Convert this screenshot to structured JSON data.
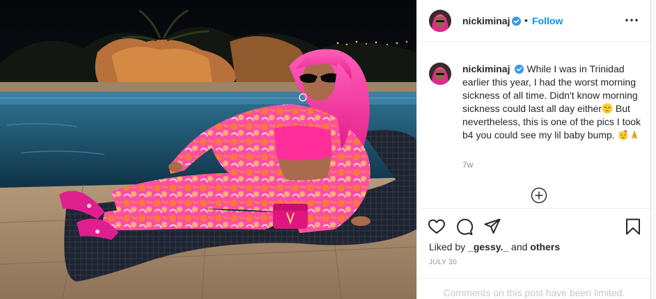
{
  "post": {
    "author": {
      "username": "nickiminaj",
      "verified": true,
      "avatar_icon": "profile-avatar-pink-hair"
    },
    "follow_separator": "•",
    "follow_label": "Follow",
    "more_icon": "ellipsis-icon",
    "photo": {
      "description_icon": "photo-pink-outfit-poolside-lounger"
    },
    "caption": {
      "part1": "While I was in Trinidad earlier this year, I had the worst morning sickness of all time. Didn't know morning sickness could last all day either",
      "emoji1": "weary-face",
      "part2": " But nevertheless, this is one of the pics I took b4 you could see my lil baby bump. ",
      "emoji2": "partying-face",
      "emoji3": "folded-hands"
    },
    "time_ago": "7w",
    "load_more_icon": "plus-circle-icon",
    "actions": {
      "like_icon": "heart-icon",
      "comment_icon": "speech-bubble-icon",
      "share_icon": "paper-plane-icon",
      "save_icon": "bookmark-icon"
    },
    "likes": {
      "prefix": "Liked by ",
      "user": "_gessy._",
      "middle": " and ",
      "others": "others"
    },
    "date": "JULY 30",
    "comments_notice": "Comments on this post have been limited."
  },
  "colors": {
    "link": "#0095f6",
    "text": "#262626",
    "muted": "#8e8e8e",
    "border": "#efefef",
    "hair_pink": "#ff3fa8",
    "outfit_orange": "#f26a3a"
  }
}
